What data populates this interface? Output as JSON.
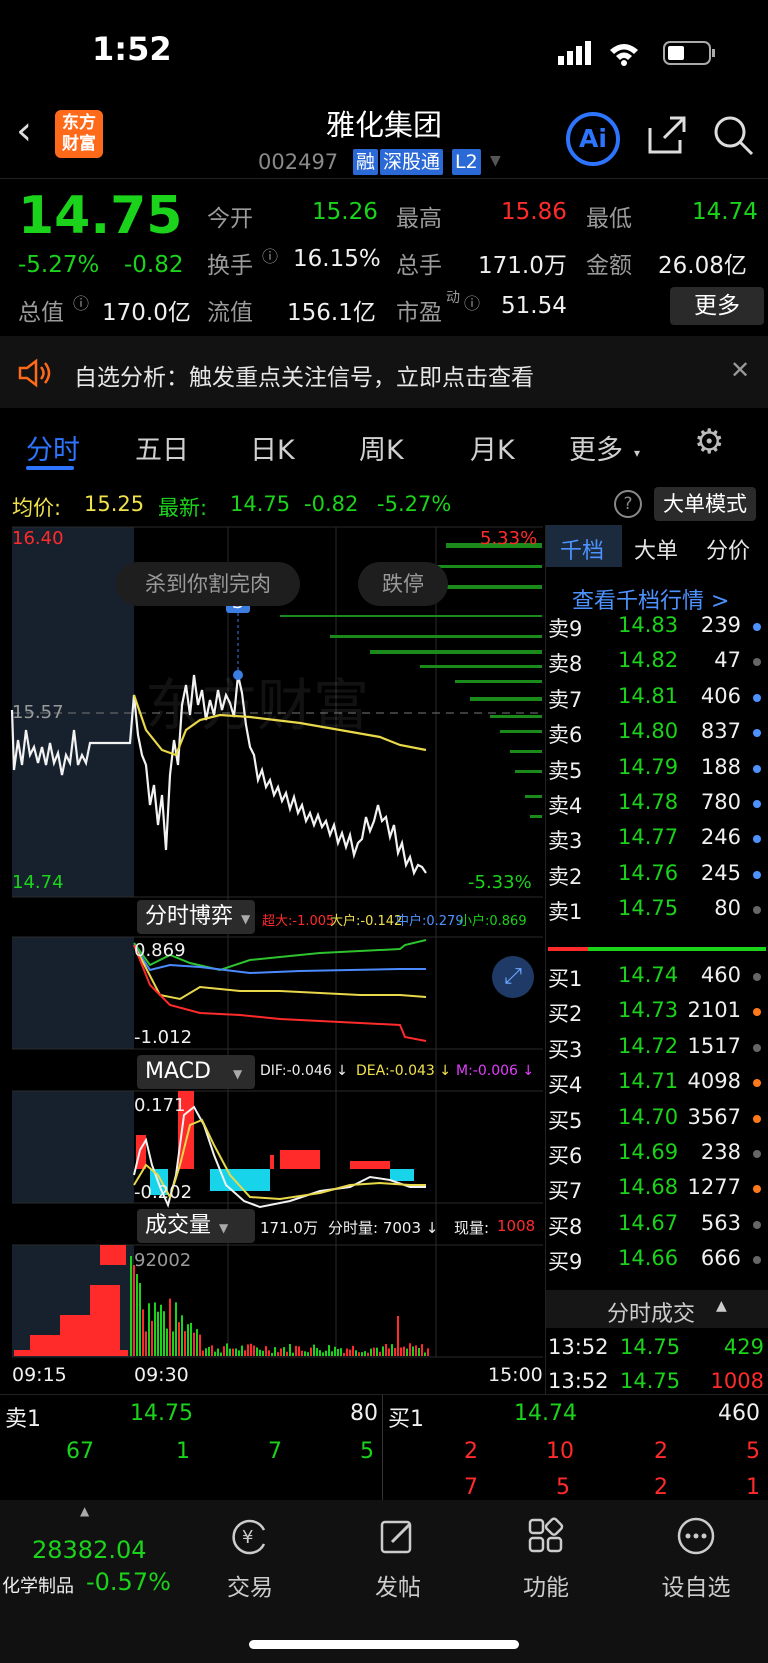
{
  "status": {
    "time": "1:52"
  },
  "header": {
    "title": "雅化集团",
    "code": "002497",
    "tags": [
      "融",
      "深股通",
      "L2"
    ],
    "logo": "东方\n财富",
    "ai": "Ai"
  },
  "quote": {
    "price": "14.75",
    "pct": "-5.27%",
    "chg": "-0.82",
    "open_label": "今开",
    "open": "15.26",
    "high_label": "最高",
    "high": "15.86",
    "low_label": "最低",
    "low": "14.74",
    "turnover_label": "换手",
    "turnover": "16.15%",
    "vol_label": "总手",
    "vol": "171.0万",
    "amount_label": "金额",
    "amount": "26.08亿",
    "mcap_label": "总值",
    "mcap": "170.0亿",
    "float_label": "流值",
    "float": "156.1亿",
    "pe_label": "市盈",
    "pe_sup": "动",
    "pe": "51.54",
    "more": "更多"
  },
  "notice": {
    "text": "自选分析：触发重点关注信号，立即点击查看"
  },
  "tabs": [
    "分时",
    "五日",
    "日K",
    "周K",
    "月K",
    "更多"
  ],
  "chart": {
    "avg_label": "均价:",
    "avg": "15.25",
    "latest_label": "最新:",
    "latest": "14.75",
    "latest_chg": "-0.82",
    "latest_pct": "-5.27%",
    "big_order": "大单模式",
    "y_high": "16.40",
    "y_mid": "15.57",
    "y_low": "14.74",
    "pct_high": "5.33%",
    "pct_low": "-5.33%",
    "bubble1": "杀到你割完肉",
    "bubble2": "跌停",
    "marker": "S",
    "watermark": "东方财富",
    "game_title": "分时博弈",
    "game_legend": {
      "a": "超大:-1.005",
      "b": "大户:-0.142",
      "c": "中户:0.279",
      "d": "小户:0.869"
    },
    "game_high": "0.869",
    "game_low": "-1.012",
    "macd_title": "MACD",
    "macd_legend": {
      "dif": "DIF:-0.046 ↓",
      "dea": "DEA:-0.043 ↓",
      "m": "M:-0.006 ↓"
    },
    "macd_high": "0.171",
    "macd_low": "-0.202",
    "vol_title": "成交量",
    "vol_legend": {
      "total": "171.0万",
      "tick": "分时量: 7003 ↓",
      "now_label": "现量:",
      "now": "1008"
    },
    "vol_max": "92002",
    "x_labels": [
      "09:15",
      "09:30",
      "15:00"
    ]
  },
  "orderbook": {
    "tabs": [
      "千档",
      "大单",
      "分价"
    ],
    "link": "查看千档行情 >",
    "sells": [
      [
        "卖9",
        "14.83",
        "239"
      ],
      [
        "卖8",
        "14.82",
        "47"
      ],
      [
        "卖7",
        "14.81",
        "406"
      ],
      [
        "卖6",
        "14.80",
        "837"
      ],
      [
        "卖5",
        "14.79",
        "188"
      ],
      [
        "卖4",
        "14.78",
        "780"
      ],
      [
        "卖3",
        "14.77",
        "246"
      ],
      [
        "卖2",
        "14.76",
        "245"
      ],
      [
        "卖1",
        "14.75",
        "80"
      ]
    ],
    "buys": [
      [
        "买1",
        "14.74",
        "460"
      ],
      [
        "买2",
        "14.73",
        "2101"
      ],
      [
        "买3",
        "14.72",
        "1517"
      ],
      [
        "买4",
        "14.71",
        "4098"
      ],
      [
        "买5",
        "14.70",
        "3567"
      ],
      [
        "买6",
        "14.69",
        "238"
      ],
      [
        "买7",
        "14.68",
        "1277"
      ],
      [
        "买8",
        "14.67",
        "563"
      ],
      [
        "买9",
        "14.66",
        "666"
      ]
    ],
    "ticks_title": "分时成交",
    "ticks": [
      [
        "13:52",
        "14.75",
        "429"
      ],
      [
        "13:52",
        "14.75",
        "1008"
      ]
    ]
  },
  "level1": {
    "sell_label": "卖1",
    "sell_price": "14.75",
    "sell_vol": "80",
    "buy_label": "买1",
    "buy_price": "14.74",
    "buy_vol": "460",
    "sell_q": [
      "67",
      "1",
      "7",
      "5"
    ],
    "buy_q1": [
      "2",
      "10",
      "2",
      "5"
    ],
    "buy_q2": [
      "7",
      "5",
      "2",
      "1"
    ]
  },
  "tabbar": {
    "index_value": "28382.04",
    "index_name": "化学制品",
    "index_pct": "-0.57%",
    "items": [
      "交易",
      "发帖",
      "功能",
      "设自选"
    ]
  }
}
